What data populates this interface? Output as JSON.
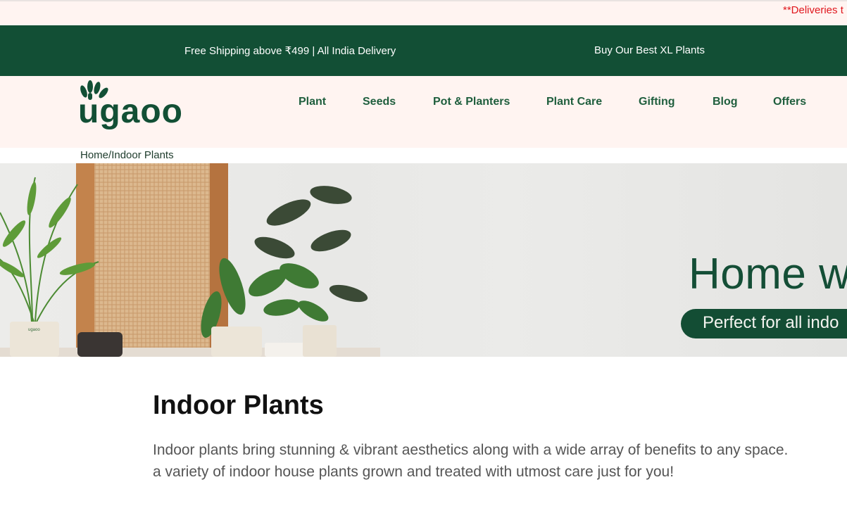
{
  "notice": {
    "text": "**Deliveries t"
  },
  "promo": {
    "left": "Free Shipping above ₹499 | All India Delivery",
    "right": "Buy Our Best XL Plants"
  },
  "brand": {
    "logo_text": "ugaoo",
    "color": "#124f35"
  },
  "nav": {
    "items": [
      {
        "label": "Plant"
      },
      {
        "label": "Seeds"
      },
      {
        "label": "Pot & Planters"
      },
      {
        "label": "Plant Care"
      },
      {
        "label": "Gifting"
      },
      {
        "label": "Blog"
      },
      {
        "label": "Offers"
      }
    ]
  },
  "breadcrumb": {
    "home": "Home",
    "separator": "/",
    "current": "Indoor Plants"
  },
  "banner": {
    "heading": "Home w",
    "pill": "Perfect for all indo",
    "pot_logo": "ugaoo"
  },
  "main": {
    "title": "Indoor Plants",
    "intro_line1": "Indoor plants bring stunning & vibrant aesthetics along with a wide array of benefits to any space.",
    "intro_line2": "a variety of indoor house plants grown and treated with utmost care just for you!"
  },
  "colors": {
    "dark_green": "#124f35",
    "nav_green": "#1f5e3d",
    "blush": "#fff4f1",
    "notice_red": "#e0161c"
  }
}
